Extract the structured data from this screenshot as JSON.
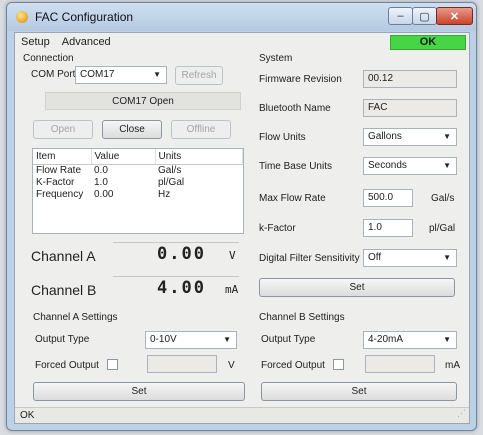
{
  "window": {
    "title": "FAC Configuration",
    "controls": {
      "minimize": "–",
      "maximize": "▢",
      "close": "✕"
    }
  },
  "menu": {
    "items": [
      "Setup",
      "Advanced"
    ],
    "status_indicator": "OK"
  },
  "connection": {
    "group_label": "Connection",
    "com_port_label": "COM Port:",
    "com_port_value": "COM17",
    "refresh_label": "Refresh",
    "status_text": "COM17 Open",
    "open_label": "Open",
    "close_label": "Close",
    "offline_label": "Offline"
  },
  "values_table": {
    "headers": [
      "Item",
      "Value",
      "Units"
    ],
    "rows": [
      [
        "Flow Rate",
        "0.0",
        "Gal/s"
      ],
      [
        "K-Factor",
        "1.0",
        "pl/Gal"
      ],
      [
        "Frequency",
        "0.00",
        "Hz"
      ]
    ]
  },
  "channels": {
    "a": {
      "label": "Channel A",
      "value": "0.00",
      "unit": "V"
    },
    "b": {
      "label": "Channel B",
      "value": "4.00",
      "unit": "mA"
    }
  },
  "system": {
    "group_label": "System",
    "firmware_label": "Firmware Revision",
    "firmware_value": "00.12",
    "bt_label": "Bluetooth Name",
    "bt_value": "FAC",
    "flow_units_label": "Flow Units",
    "flow_units_value": "Gallons",
    "time_base_label": "Time Base Units",
    "time_base_value": "Seconds",
    "max_flow_label": "Max Flow Rate",
    "max_flow_value": "500.0",
    "max_flow_unit": "Gal/s",
    "kfactor_label": "k-Factor",
    "kfactor_value": "1.0",
    "kfactor_unit": "pl/Gal",
    "filter_label": "Digital Filter Sensitivity",
    "filter_value": "Off",
    "set_label": "Set"
  },
  "channel_a_settings": {
    "group_label": "Channel A Settings",
    "output_type_label": "Output Type",
    "output_type_value": "0-10V",
    "forced_output_label": "Forced Output",
    "forced_output_checked": false,
    "forced_output_value": "",
    "unit": "V",
    "set_label": "Set"
  },
  "channel_b_settings": {
    "group_label": "Channel B Settings",
    "output_type_label": "Output Type",
    "output_type_value": "4-20mA",
    "forced_output_label": "Forced Output",
    "forced_output_checked": false,
    "forced_output_value": "",
    "unit": "mA",
    "set_label": "Set"
  },
  "statusbar": {
    "text": "OK"
  },
  "colors": {
    "ok_green": "#45d545",
    "title_bar": "#bcd0e6",
    "close_red": "#c9442c"
  }
}
